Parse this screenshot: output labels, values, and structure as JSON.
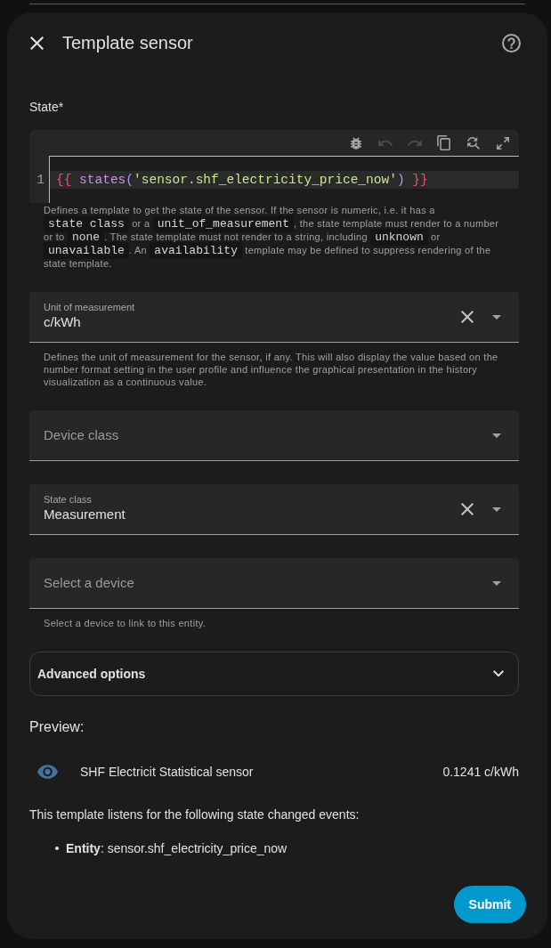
{
  "dialog": {
    "title": "Template sensor"
  },
  "state_editor": {
    "label": "State*",
    "toolbar": [
      {
        "kind": "debug",
        "disabled": false
      },
      {
        "kind": "undo",
        "disabled": true
      },
      {
        "kind": "redo",
        "disabled": true
      },
      {
        "kind": "copy",
        "disabled": false
      },
      {
        "kind": "find_replace",
        "disabled": false
      },
      {
        "kind": "fullscreen",
        "disabled": false
      }
    ],
    "lines": [
      {
        "number": "1",
        "active": true,
        "tokens": [
          {
            "text": "{{ ",
            "color": "#f0506e"
          },
          {
            "text": "states",
            "color": "#c792ea"
          },
          {
            "text": "(",
            "color": "#9aa5f0"
          },
          {
            "text": "'sensor.shf_electricity_price_now'",
            "color": "#c3e88d"
          },
          {
            "text": ") ",
            "color": "#9aa5f0"
          },
          {
            "text": "}}",
            "color": "#f0506e"
          }
        ]
      }
    ],
    "helper": [
      {
        "kind": "text",
        "text": "Defines a template to get the state of the sensor. If the sensor is numeric, i.e. it has a "
      },
      {
        "kind": "code",
        "text": "state class"
      },
      {
        "kind": "text",
        "text": " or a "
      },
      {
        "kind": "code",
        "text": "unit_of_measurement"
      },
      {
        "kind": "text",
        "text": ", the state template must render to a number or to "
      },
      {
        "kind": "code",
        "text": "none"
      },
      {
        "kind": "text",
        "text": ". The state template must not render to a string, including "
      },
      {
        "kind": "code",
        "text": "unknown"
      },
      {
        "kind": "text",
        "text": " or "
      },
      {
        "kind": "code",
        "text": "unavailable"
      },
      {
        "kind": "text",
        "text": ". An "
      },
      {
        "kind": "code",
        "text": "availability"
      },
      {
        "kind": "text",
        "text": " template may be defined to suppress rendering of the state template."
      }
    ]
  },
  "fields": [
    {
      "label": "Unit of measurement",
      "value": "c/kWh",
      "helper": "Defines the unit of measurement for the sensor, if any. This will also display the value based on the number format setting in the user profile and influence the graphical presentation in the history visualization as a continuous value."
    },
    {
      "placeholder": "Device class"
    },
    {
      "label": "State class",
      "value": "Measurement"
    },
    {
      "placeholder": "Select a device",
      "helper": "Select a device to link to this entity."
    }
  ],
  "advanced_options": {
    "label": "Advanced options",
    "expanded": false
  },
  "preview": {
    "heading": "Preview:",
    "entity_name": "SHF Electricit Statistical sensor",
    "state": "0.1241 c/kWh"
  },
  "listeners": {
    "intro": "This template listens for the following state changed events:",
    "items": [
      "**Entity**: sensor.shf_electricity_price_now"
    ]
  },
  "submit": {
    "label": "Submit"
  }
}
